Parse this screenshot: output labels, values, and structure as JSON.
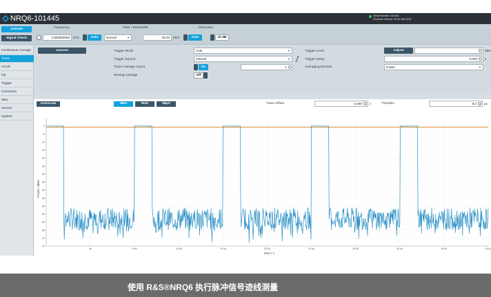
{
  "app": {
    "title": "NRQ6-101445",
    "serial_line1": "Serial Number: 101445",
    "serial_line2": "Firmware Version: 02.00.18071101"
  },
  "controls": {
    "autoset_label": "Autoset",
    "signal_check_label": "Signal Check",
    "frequency_label": "Frequency",
    "frequency_value": "1,000000000",
    "frequency_unit": "GHz",
    "filter_label": "Filter / Bandwidth",
    "filter_auto_label": "Auto",
    "filter_select_value": "Normal",
    "filter_value": "25.00",
    "filter_unit": "MHz",
    "attenuator_label": "Attenuator",
    "attenuator_auto_label": "Auto",
    "attenuator_value": "10 dB"
  },
  "sidebar": {
    "items": [
      {
        "label": "Continuous Average",
        "active": false
      },
      {
        "label": "Trace",
        "active": true
      },
      {
        "label": "ACLR",
        "active": false
      },
      {
        "label": "I/Q",
        "active": false
      },
      {
        "label": "Trigger",
        "active": false
      },
      {
        "label": "Correction",
        "active": false
      },
      {
        "label": "Misc",
        "active": false
      },
      {
        "label": "Sensor",
        "active": false
      },
      {
        "label": "System",
        "active": false
      }
    ]
  },
  "panel": {
    "autoset_label": "Autoset",
    "trigger_mode_label": "Trigger Mode",
    "trigger_mode_value": "Auto",
    "trigger_source_label": "Trigger Source",
    "trigger_source_value": "Internal",
    "trace_avg_label": "Trace Average Count",
    "trace_avg_toggle": "On",
    "trace_avg_value": "1",
    "moving_avg_label": "Moving Average",
    "moving_avg_toggle": "Off",
    "trigger_level_label": "Trigger Level",
    "adjust_label": "Adjust",
    "trigger_level_unit": "dBm",
    "trigger_delay_label": "Trigger Delay",
    "trigger_delay_value": "0,000",
    "trigger_delay_unit": "s",
    "averaging_domain_label": "Averaging Domain",
    "averaging_domain_value": "Power"
  },
  "trace_bar": {
    "autoscale_label": "Autoscale",
    "tabs": [
      "dBm",
      "Watt",
      "dBµV"
    ],
    "active_tab": "dBm",
    "trace_offset_label": "Trace Offset",
    "trace_offset_value": "0,000",
    "trace_offset_unit": "s",
    "time_div_label": "Time/Div",
    "time_div_value": "5,0",
    "time_div_unit": "µs"
  },
  "chart_data": {
    "type": "line",
    "xlabel": "Time / s",
    "ylabel": "Power / dBm",
    "xlim": [
      0,
      50
    ],
    "ylim": [
      -75,
      5
    ],
    "x_ticks": [
      "5u",
      "9.5u",
      "14.5u",
      "19.5u",
      "24.5u",
      "29.5u",
      "34.5u",
      "39.5u",
      "44.5u",
      "49.5u"
    ],
    "y_ticks": [
      "0",
      "-5",
      "-10",
      "-15",
      "-20",
      "-25",
      "-30",
      "-35",
      "-40",
      "-45",
      "-50",
      "-55",
      "-60",
      "-65",
      "-70",
      "-75"
    ],
    "series": [
      {
        "color": "#2a8fc4",
        "pulse_on_level": 0,
        "noise_floor": -58,
        "pulses": [
          [
            0,
            2
          ],
          [
            10,
            12
          ],
          [
            20,
            22
          ],
          [
            30,
            32
          ],
          [
            40,
            42
          ]
        ]
      }
    ],
    "reference_line": {
      "value": 0,
      "color": "#e08a2c"
    }
  },
  "caption": {
    "text": "使用 R&S®NRQ6 执行脉冲信号迹线测量"
  }
}
